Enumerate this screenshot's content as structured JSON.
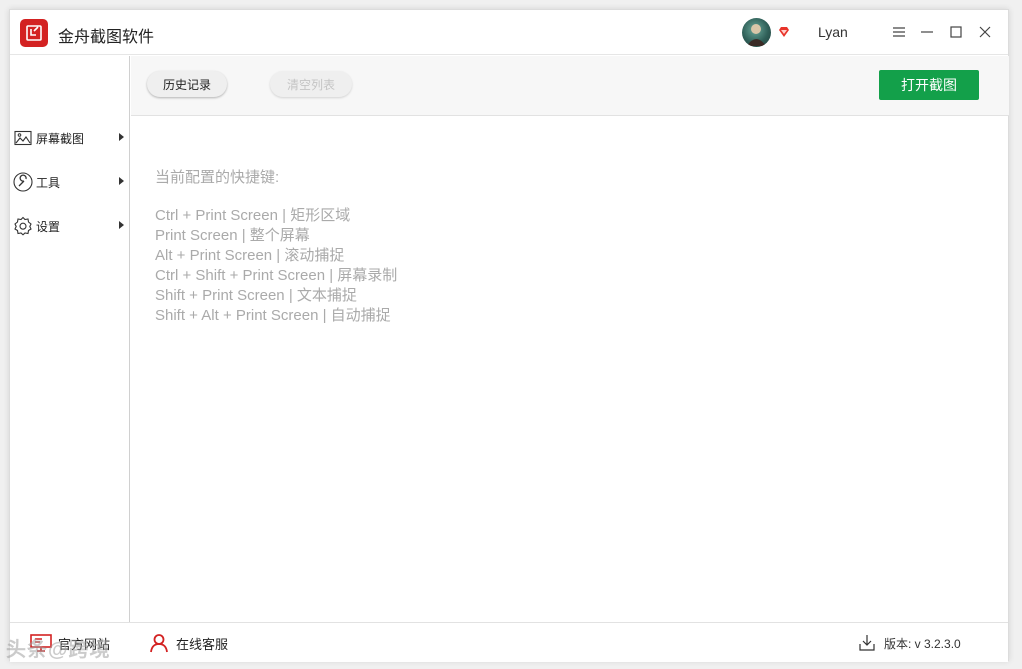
{
  "app": {
    "title": "金舟截图软件",
    "username": "Lyan"
  },
  "toolbar": {
    "history_label": "历史记录",
    "clear_label": "清空列表",
    "open_label": "打开截图"
  },
  "sidebar": {
    "items": [
      {
        "label": "屏幕截图",
        "icon": "image-icon"
      },
      {
        "label": "工具",
        "icon": "wrench-icon"
      },
      {
        "label": "设置",
        "icon": "gear-icon"
      }
    ]
  },
  "hotkeys": {
    "title": "当前配置的快捷键:",
    "lines": [
      "Ctrl + Print Screen  |  矩形区域",
      "Print Screen  |  整个屏幕",
      "Alt + Print Screen  |  滚动捕捉",
      "Ctrl + Shift + Print Screen  |  屏幕录制",
      "Shift + Print Screen  |  文本捕捉",
      "Shift + Alt + Print Screen  |  自动捕捉"
    ]
  },
  "footer": {
    "website_label": "官方网站",
    "support_label": "在线客服",
    "version_label": "版本: v 3.2.3.0"
  },
  "watermark": "头条@跨境",
  "colors": {
    "accent_green": "#13a04a",
    "brand_red": "#d32222",
    "hint_gray": "#aaaaaa"
  }
}
